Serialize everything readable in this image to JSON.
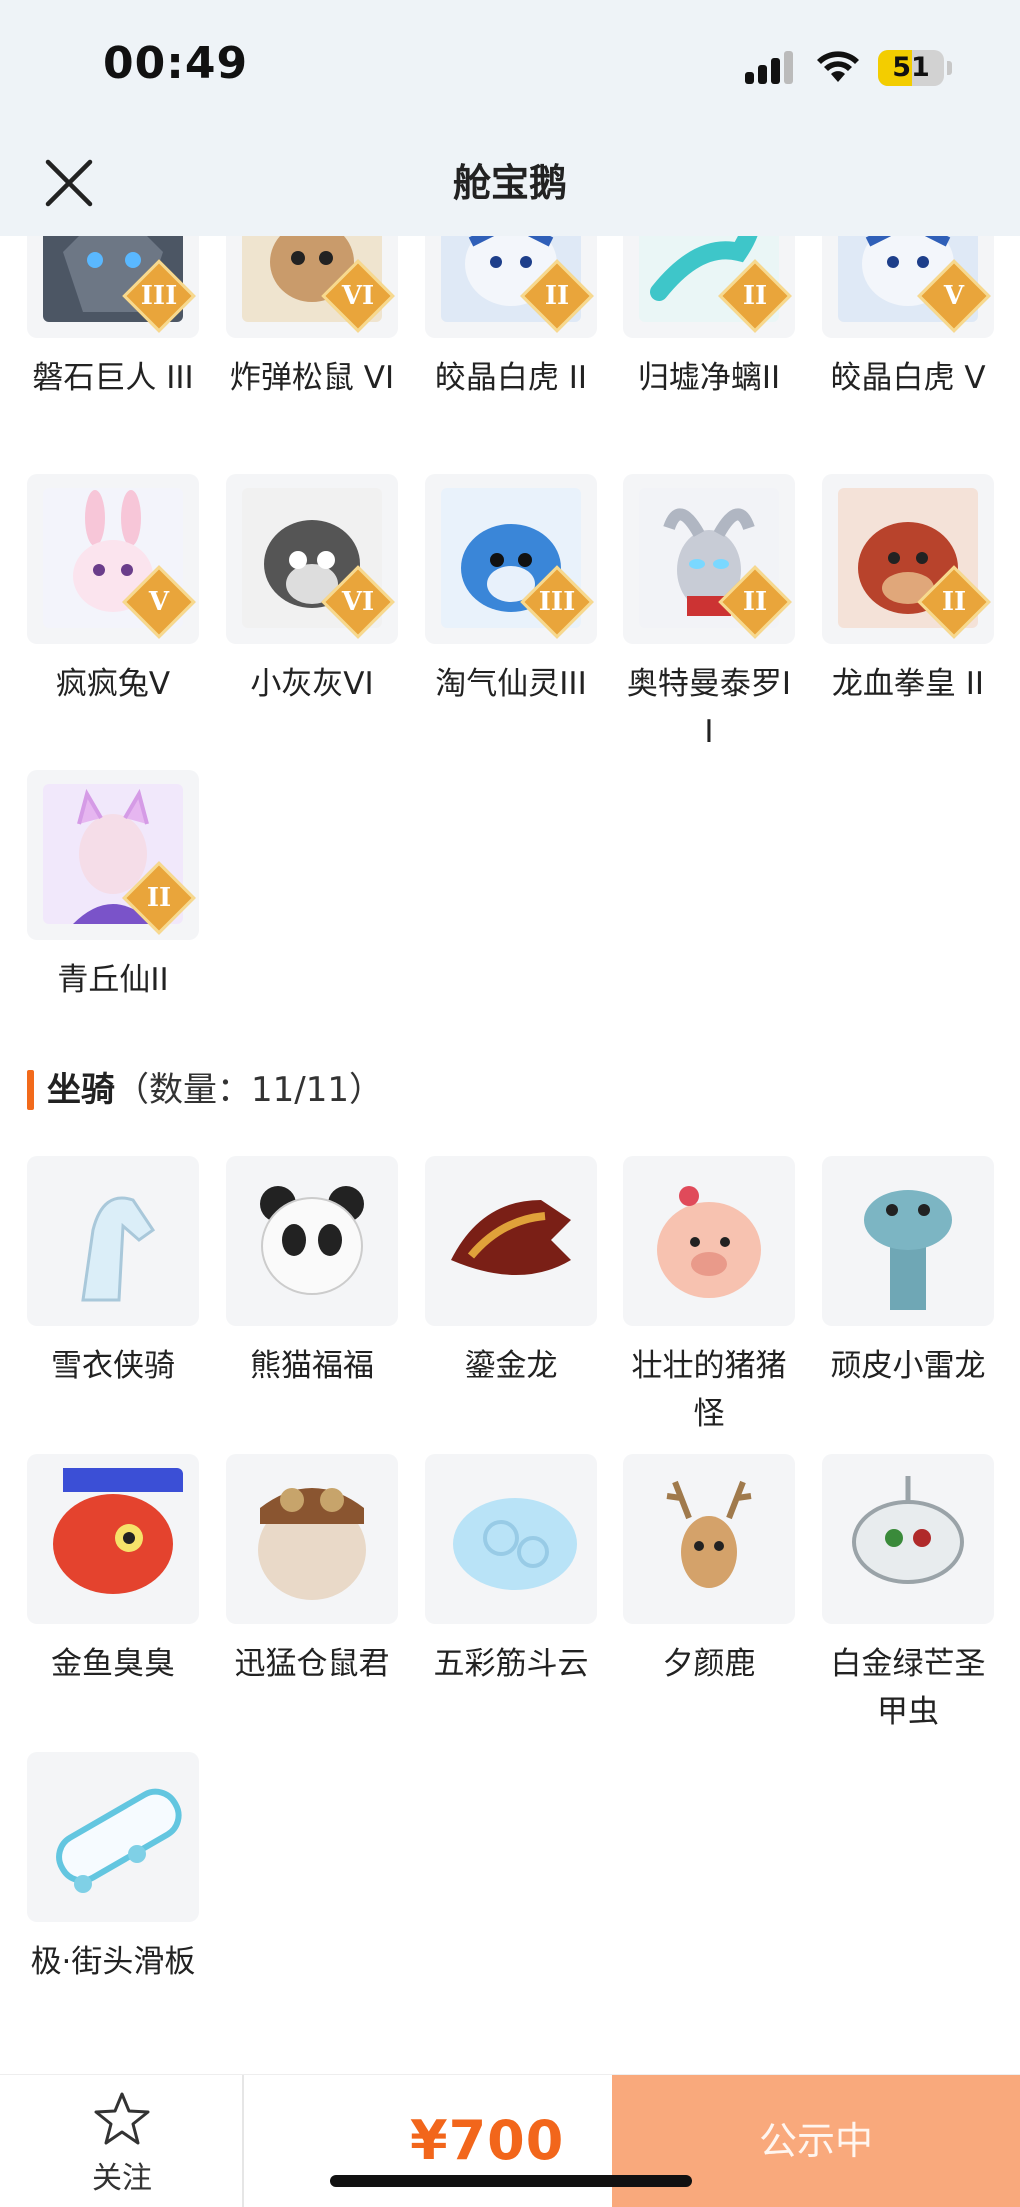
{
  "status_bar": {
    "time": "00:49",
    "battery": "51",
    "battery_level": 0.51
  },
  "nav": {
    "title": "舱宝鹅",
    "close_icon": "close-icon"
  },
  "pets": [
    {
      "name": "磐石巨人 III",
      "rank": "III"
    },
    {
      "name": "炸弹松鼠 VI",
      "rank": "VI"
    },
    {
      "name": "皎晶白虎 II",
      "rank": "II"
    },
    {
      "name": "归墟净螭II",
      "rank": "II"
    },
    {
      "name": "皎晶白虎 V",
      "rank": "V"
    },
    {
      "name": "疯疯兔V",
      "rank": "V"
    },
    {
      "name": "小灰灰VI",
      "rank": "VI"
    },
    {
      "name": "淘气仙灵III",
      "rank": "III"
    },
    {
      "name": "奥特曼泰罗II",
      "rank": "II"
    },
    {
      "name": "龙血拳皇 II",
      "rank": "II"
    },
    {
      "name": "青丘仙II",
      "rank": "II"
    }
  ],
  "mounts_section": {
    "title": "坐骑",
    "count": "（数量：11/11）"
  },
  "mounts": [
    {
      "name": "雪衣侠骑"
    },
    {
      "name": "熊猫福福"
    },
    {
      "name": "鎏金龙"
    },
    {
      "name": "壮壮的猪猪怪"
    },
    {
      "name": "顽皮小雷龙"
    },
    {
      "name": "金鱼臭臭"
    },
    {
      "name": "迅猛仓鼠君"
    },
    {
      "name": "五彩筋斗云"
    },
    {
      "name": "夕颜鹿"
    },
    {
      "name": "白金绿芒圣甲虫"
    },
    {
      "name": "极·街头滑板"
    }
  ],
  "bottom": {
    "follow_label": "关注",
    "follow_icon": "star-icon",
    "price": "¥700",
    "status_label": "公示中"
  },
  "colors": {
    "accent": "#f26a1b",
    "status_button": "#f9a97c",
    "header_bg": "#eef3f7"
  }
}
